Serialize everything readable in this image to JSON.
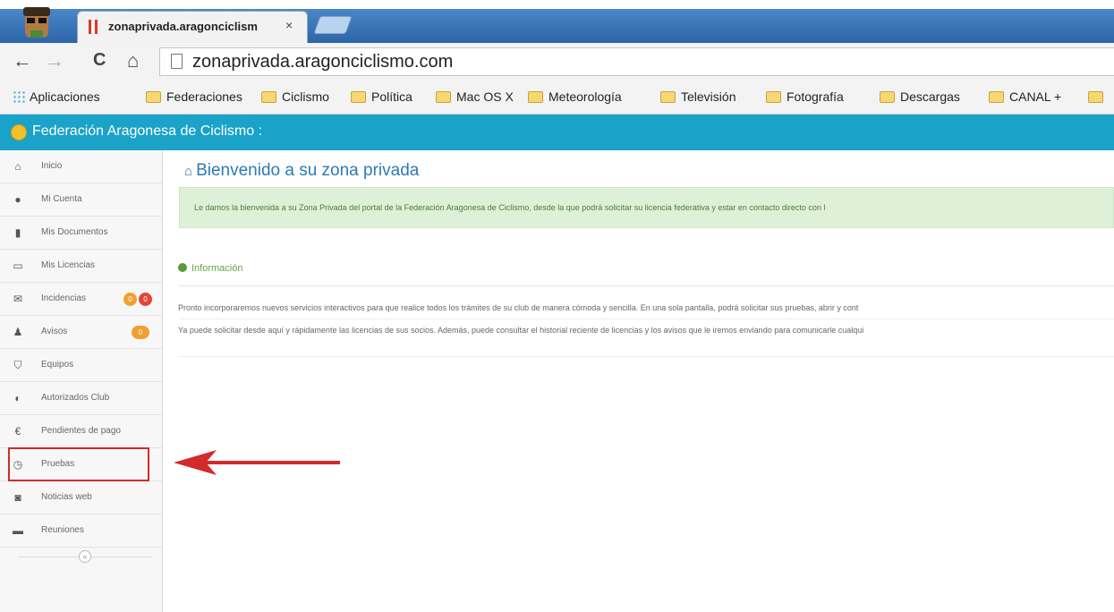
{
  "browser": {
    "tab_title": "zonaprivada.aragonciclism",
    "tab_close": "×",
    "url": "zonaprivada.aragonciclismo.com",
    "nav": {
      "back": "←",
      "forward": "→",
      "reload": "C",
      "home": "⌂"
    }
  },
  "bookmarks": [
    {
      "label": "Aplicaciones",
      "icon": "apps-grid-icon"
    },
    {
      "label": "Federaciones",
      "icon": "folder-icon"
    },
    {
      "label": "Ciclismo",
      "icon": "folder-icon"
    },
    {
      "label": "Política",
      "icon": "folder-icon"
    },
    {
      "label": "Mac OS X",
      "icon": "folder-icon"
    },
    {
      "label": "Meteorología",
      "icon": "folder-icon"
    },
    {
      "label": "Televisión",
      "icon": "folder-icon"
    },
    {
      "label": "Fotografía",
      "icon": "folder-icon"
    },
    {
      "label": "Descargas",
      "icon": "folder-icon"
    },
    {
      "label": "CANAL +",
      "icon": "folder-icon"
    }
  ],
  "app": {
    "title": "Federación Aragonesa de Ciclismo :",
    "accent_color": "#1aa2c9"
  },
  "sidebar": {
    "items": [
      {
        "label": "Inicio",
        "icon": "home-icon"
      },
      {
        "label": "Mi Cuenta",
        "icon": "user-icon"
      },
      {
        "label": "Mis Documentos",
        "icon": "document-icon"
      },
      {
        "label": "Mis Licencias",
        "icon": "card-icon"
      },
      {
        "label": "Incidencias",
        "icon": "envelope-icon",
        "badges": [
          "0",
          "0"
        ]
      },
      {
        "label": "Avisos",
        "icon": "bell-icon",
        "badges": [
          "0"
        ]
      },
      {
        "label": "Equipos",
        "icon": "shield-icon"
      },
      {
        "label": "Autorizados Club",
        "icon": "half-shield-icon"
      },
      {
        "label": "Pendientes de pago",
        "icon": "euro-icon"
      },
      {
        "label": "Pruebas",
        "icon": "clock-icon"
      },
      {
        "label": "Noticias web",
        "icon": "camera-icon"
      },
      {
        "label": "Reuniones",
        "icon": "briefcase-icon"
      }
    ],
    "collapse": "«",
    "highlighted_item": "Pruebas"
  },
  "main": {
    "heading": "Bienvenido a su zona privada",
    "alert": "Le damos la bienvenida a su Zona Privada del portal de la Federación Aragonesa de Ciclismo, desde la que podrá solicitar su licencia federativa y estar en contacto directo con l",
    "info_heading": "Información",
    "paragraphs": [
      "Pronto incorporaremos nuevos servicios interactivos para que realice todos los trámites de su club de manera cómoda y sencilla. En una sola pantalla, podrá solicitar sus pruebas, abrir y cont",
      "Ya puede solicitar desde aquí y rápidamente las licencias de sus socios. Además, puede consultar el historial reciente de licencias y los avisos que le iremos enviando para comunicarle cualqui"
    ]
  },
  "annotation": {
    "arrow_color": "#d32a2a"
  }
}
